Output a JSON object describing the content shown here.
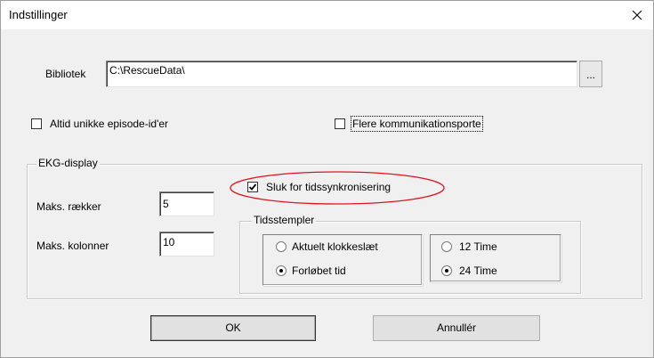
{
  "window": {
    "title": "Indstillinger"
  },
  "library": {
    "label": "Bibliotek",
    "value": "C:\\RescueData\\",
    "browse_label": "..."
  },
  "options": {
    "unique_ids_label": "Altid unikke episode-id'er",
    "unique_ids_checked": false,
    "multi_ports_label": "Flere kommunikationsporte",
    "multi_ports_checked": false
  },
  "ekg": {
    "group_label": "EKG-display",
    "max_rows_label": "Maks. rækker",
    "max_rows_value": "5",
    "max_cols_label": "Maks. kolonner",
    "max_cols_value": "10",
    "time_sync_label": "Sluk for tidssynkronisering",
    "time_sync_checked": true
  },
  "timestamps": {
    "group_label": "Tidsstempler",
    "current_time_label": "Aktuelt klokkeslæt",
    "elapsed_time_label": "Forløbet tid",
    "selected_mode": "elapsed",
    "hour12_label": "12 Time",
    "hour24_label": "24 Time",
    "selected_format": "24"
  },
  "buttons": {
    "ok_label": "OK",
    "cancel_label": "Annullér"
  },
  "annotation": {
    "color": "#e0141e"
  }
}
